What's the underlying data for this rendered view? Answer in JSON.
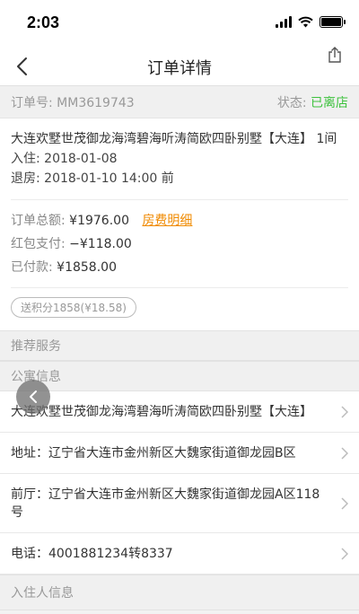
{
  "status_bar": {
    "time": "2:03"
  },
  "nav": {
    "title": "订单详情"
  },
  "order": {
    "number_label": "订单号:",
    "number": "MM3619743",
    "status_label": "状态:",
    "status": "已离店",
    "status_color": "#3ec23e"
  },
  "booking": {
    "hotel_name": "大连欢墅世茂御龙海湾碧海听涛简欧四卧别墅【大连】 1间",
    "checkin": "入住:  2018-01-08",
    "checkout": "退房:  2018-01-10 14:00 前"
  },
  "payment": {
    "total_label": "订单总额:",
    "total_value": "¥1976.00",
    "detail_link": "房费明细",
    "redpacket_label": "红包支付:",
    "redpacket_value": "−¥118.00",
    "paid_label": "已付款:",
    "paid_value": "¥1858.00",
    "points_badge": "送积分1858(¥18.58)"
  },
  "sections": {
    "recommend": "推荐服务",
    "apartment": "公寓信息",
    "guest": "入住人信息"
  },
  "apartment_info": {
    "name": "大连欢墅世茂御龙海湾碧海听涛简欧四卧别墅【大连】",
    "address": "地址：辽宁省大连市金州新区大魏家街道御龙园B区",
    "frontdesk": "前厅：辽宁省大连市金州新区大魏家街道御龙园A区118号",
    "phone": "电话：4001881234转8337"
  }
}
